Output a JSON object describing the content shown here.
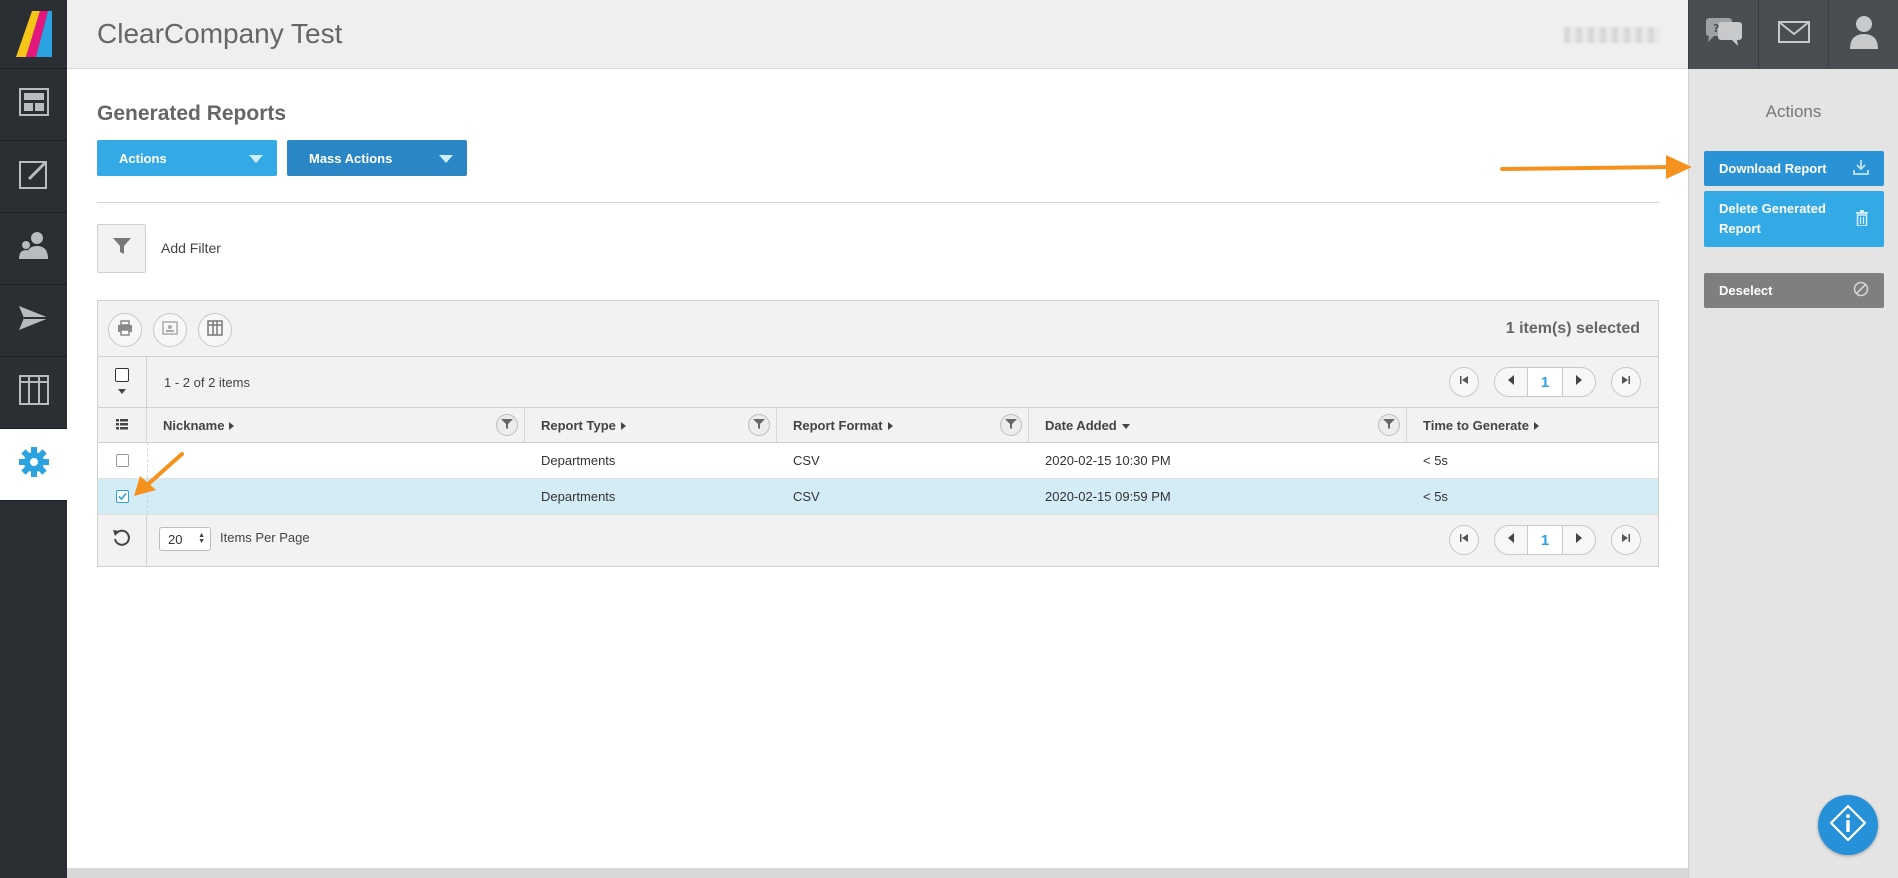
{
  "header": {
    "title": "ClearCompany Test"
  },
  "main": {
    "section_title": "Generated Reports",
    "actions_label": "Actions",
    "mass_actions_label": "Mass Actions",
    "add_filter_label": "Add Filter"
  },
  "grid": {
    "selected_count": "1 item(s) selected",
    "item_range": "1 - 2 of 2 items",
    "current_page": "1",
    "columns": [
      "Nickname",
      "Report Type",
      "Report Format",
      "Date Added",
      "Time to Generate"
    ],
    "rows": [
      {
        "nickname": "",
        "report_type": "Departments",
        "report_format": "CSV",
        "date_added": "2020-02-15 10:30 PM",
        "time_to_generate": "< 5s",
        "checked": false
      },
      {
        "nickname": "",
        "report_type": "Departments",
        "report_format": "CSV",
        "date_added": "2020-02-15 09:59 PM",
        "time_to_generate": "< 5s",
        "checked": true
      }
    ],
    "items_per_page": "20",
    "items_per_page_label": "Items Per Page"
  },
  "right_panel": {
    "title": "Actions",
    "download_label": "Download Report",
    "delete_label": "Delete Generated Report",
    "deselect_label": "Deselect"
  },
  "colors": {
    "accent_light": "#33a9e6",
    "accent_dark": "#2a86c4",
    "annotation_arrow": "#f5921e",
    "nav_bg": "#2b2f33"
  }
}
